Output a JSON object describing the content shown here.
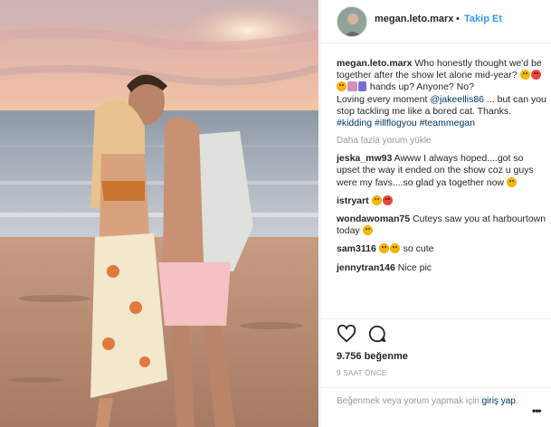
{
  "post": {
    "username": "megan.leto.marx",
    "dot": "•",
    "follow_label": "Takip Et"
  },
  "caption": {
    "username": "megan.leto.marx",
    "text1": " Who honestly thought we'd be together after the show let alone mid-year? ",
    "text2": " hands up? Anyone? No?",
    "text3": "Loving every moment ",
    "mention": "@jakeellis86",
    "text4": " ... but can you stop tackling me like a bored cat. Thanks. ",
    "tags": [
      "#kidding",
      "#illflogyou",
      "#teammegan"
    ]
  },
  "more_comments_label": "Daha fazla yorum yükle",
  "comments": [
    {
      "username": "jeska_mw93",
      "text": " Awww I always hoped....got so upset the way it ended on the show coz u guys were my favs....so glad ya together now "
    },
    {
      "username": "istryart",
      "text": " "
    },
    {
      "username": "wondawoman75",
      "text": " Cuteys saw you at harbourtown today "
    },
    {
      "username": "sam3116",
      "text": " so cute"
    },
    {
      "username": "jennytran146",
      "text": " Nice pic"
    }
  ],
  "likes_label": "9.756 beğenme",
  "time_label": "9 SAAT ÖNCE",
  "login": {
    "prefix": "Beğenmek veya yorum yapmak için ",
    "link": "giriş yap",
    "suffix": "."
  },
  "more_options": "•••",
  "icons": {
    "like": "heart-icon",
    "comment": "comment-bubble-icon",
    "more": "more-options-icon"
  },
  "colors": {
    "link": "#003569",
    "follow": "#3897f0",
    "muted": "#999999"
  }
}
